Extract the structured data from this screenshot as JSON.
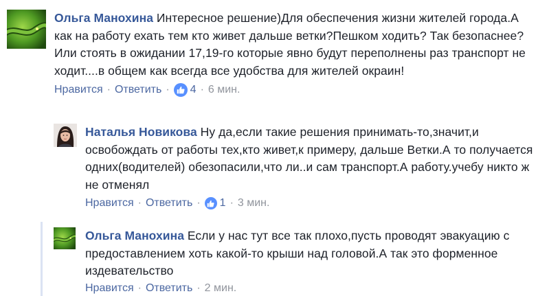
{
  "comments": [
    {
      "author": "Ольга Манохина",
      "text": "Интересное решение)Для обеспечения жизни жителей города.А как на работу ехать тем кто живет дальше ветки?Пешком ходить? Так безопаснее? Или стоять в ожидании 17,19-го которые явно будут переполнены раз транспорт не ходит....в общем как всегда все удобства для жителей окраин!",
      "like_label": "Нравится",
      "reply_label": "Ответить",
      "likes": "4",
      "time": "6 мин.",
      "avatar_icon": "green-snake-avatar"
    },
    {
      "author": "Наталья Новикова",
      "text": "Ну да,если такие решения принимать-то,значит,и освобождать от работы тех,кто живет,к примеру, дальше Ветки.А то получается одних(водителей) обезопасили,что ли..и сам транспорт.А работу.учебу никто ж не отменял",
      "like_label": "Нравится",
      "reply_label": "Ответить",
      "likes": "1",
      "time": "3 мин.",
      "avatar_icon": "woman-portrait-avatar"
    },
    {
      "author": "Ольга Манохина",
      "text": "Если у нас тут все так плохо,пусть проводят эвакуацию с предоставлением хоть какой-то крыши над головой.А так это форменное издевательство",
      "like_label": "Нравится",
      "reply_label": "Ответить",
      "time": "2 мин.",
      "avatar_icon": "green-snake-avatar"
    }
  ],
  "colors": {
    "author": "#365899",
    "link": "#4b67a1",
    "meta": "#90949c",
    "like_badge": "#5890ff",
    "thread_line": "#dbe3f3"
  }
}
